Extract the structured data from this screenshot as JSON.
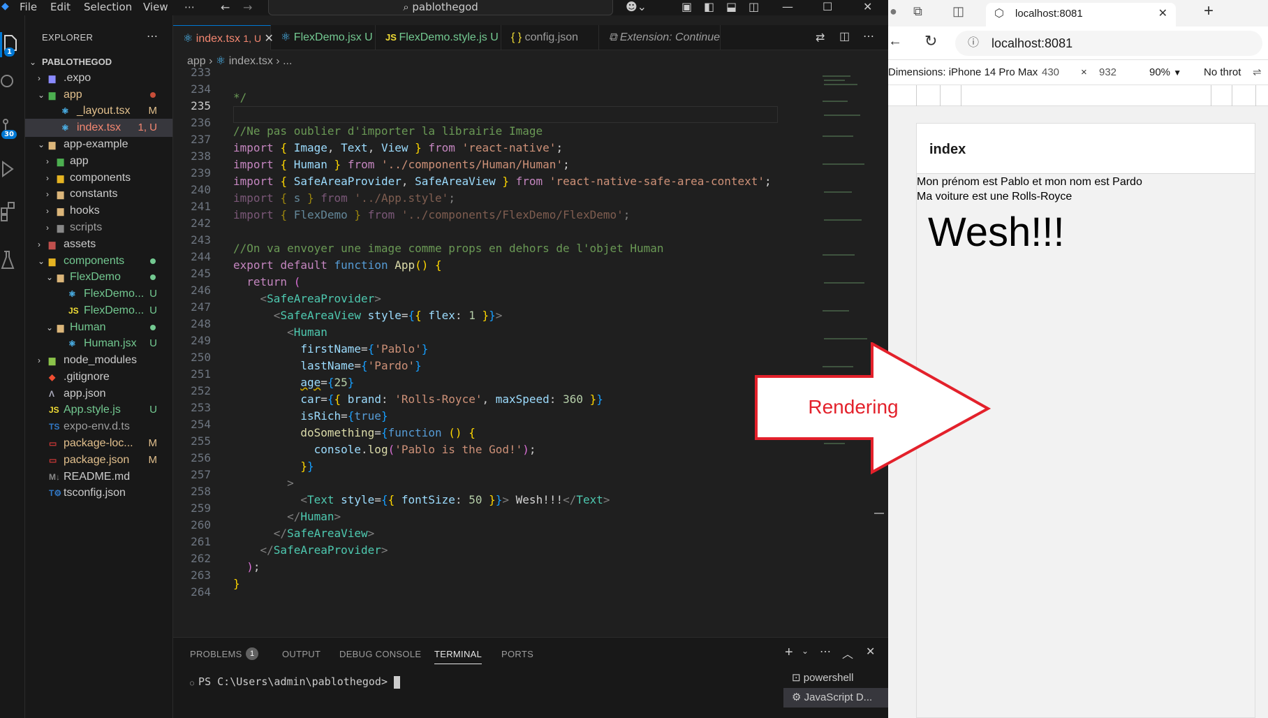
{
  "titlebar": {
    "menus": [
      "File",
      "Edit",
      "Selection",
      "View",
      "⋯"
    ],
    "search": "pablothegod"
  },
  "activity": {
    "scm_badge": "1",
    "ext_badge": "30"
  },
  "explorer": {
    "header": "EXPLORER",
    "root": "PABLOTHEGOD",
    "items": [
      {
        "label": ".expo",
        "status": ""
      },
      {
        "label": "app",
        "status": ""
      },
      {
        "label": "_layout.tsx",
        "status": "M"
      },
      {
        "label": "index.tsx",
        "status": "1, U"
      },
      {
        "label": "app-example",
        "status": ""
      },
      {
        "label": "app",
        "status": ""
      },
      {
        "label": "components",
        "status": ""
      },
      {
        "label": "constants",
        "status": ""
      },
      {
        "label": "hooks",
        "status": ""
      },
      {
        "label": "scripts",
        "status": ""
      },
      {
        "label": "assets",
        "status": ""
      },
      {
        "label": "components",
        "status": ""
      },
      {
        "label": "FlexDemo",
        "status": ""
      },
      {
        "label": "FlexDemo...",
        "status": "U"
      },
      {
        "label": "FlexDemo...",
        "status": "U"
      },
      {
        "label": "Human",
        "status": ""
      },
      {
        "label": "Human.jsx",
        "status": "U"
      },
      {
        "label": "node_modules",
        "status": ""
      },
      {
        "label": ".gitignore",
        "status": ""
      },
      {
        "label": "app.json",
        "status": ""
      },
      {
        "label": "App.style.js",
        "status": "U"
      },
      {
        "label": "expo-env.d.ts",
        "status": ""
      },
      {
        "label": "package-loc...",
        "status": "M"
      },
      {
        "label": "package.json",
        "status": "M"
      },
      {
        "label": "README.md",
        "status": ""
      },
      {
        "label": "tsconfig.json",
        "status": ""
      }
    ]
  },
  "tabs": [
    {
      "label": "index.tsx",
      "status": "1, U",
      "close": "✕"
    },
    {
      "label": "FlexDemo.jsx",
      "status": "U"
    },
    {
      "label": "FlexDemo.style.js",
      "status": "U"
    },
    {
      "label": "config.json",
      "status": ""
    },
    {
      "label": "Extension: Continue -",
      "status": ""
    }
  ],
  "breadcrumb": {
    "a": "app",
    "b": "index.tsx",
    "c": "..."
  },
  "code": {
    "line_numbers": [
      "233",
      "234",
      "235",
      "236",
      "237",
      "238",
      "239",
      "240",
      "241",
      "242",
      "243",
      "244",
      "245",
      "246",
      "247",
      "248",
      "249",
      "250",
      "251",
      "252",
      "253",
      "254",
      "255",
      "256",
      "257",
      "258",
      "259",
      "260",
      "261",
      "262",
      "263",
      "264"
    ],
    "l234": "*/",
    "l236": "//Ne pas oublier d'importer la librairie Image",
    "l243": "//On va envoyer une image comme props en dehors de l'objet Human",
    "path_rn": "'react-native'",
    "path_human": "'../components/Human/Human'",
    "path_safe": "'react-native-safe-area-context'",
    "path_style": "'../App.style'",
    "path_flex": "'../components/FlexDemo/FlexDemo'",
    "str_pablo": "'Pablo'",
    "str_pardo": "'Pardo'",
    "num_age": "25",
    "str_rolls": "'Rolls-Royce'",
    "num_speed": "360",
    "str_log": "'Pablo is the God!'",
    "num_font": "50",
    "jsx_text": " Wesh!!!"
  },
  "panel": {
    "tabs": [
      "PROBLEMS",
      "OUTPUT",
      "DEBUG CONSOLE",
      "TERMINAL",
      "PORTS"
    ],
    "problems_count": "1",
    "prompt": "PS C:\\Users\\admin\\pablothegod>",
    "terminals": [
      "powershell",
      "JavaScript D..."
    ]
  },
  "browser": {
    "tab_title": "localhost:8081",
    "url": "localhost:8081",
    "dims_label": "Dimensions: iPhone 14 Pro Max",
    "width": "430",
    "times": "×",
    "height": "932",
    "zoom": "90%",
    "throttle": "No throt"
  },
  "app": {
    "header": "index",
    "line1": "Mon prénom est Pablo et mon nom est Pardo",
    "line2": "Ma voiture est une Rolls-Royce",
    "big": "Wesh!!!"
  },
  "annotation": {
    "label": "Rendering",
    "color": "#e3212b"
  }
}
